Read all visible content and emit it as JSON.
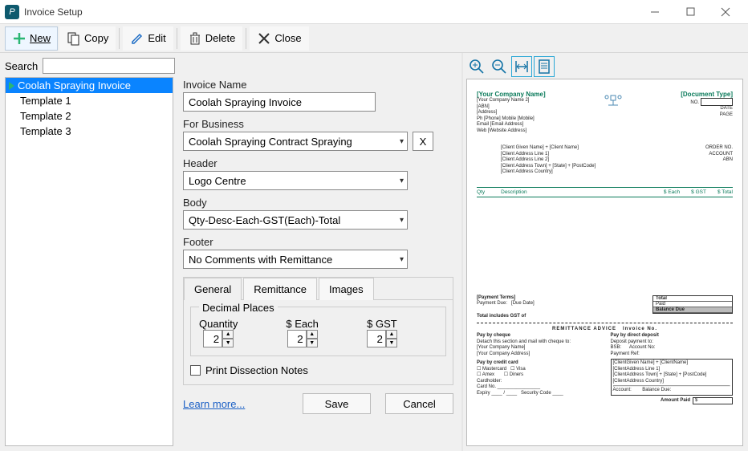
{
  "window": {
    "title": "Invoice Setup"
  },
  "toolbar": {
    "new_label": "New",
    "copy_label": "Copy",
    "edit_label": "Edit",
    "delete_label": "Delete",
    "close_label": "Close"
  },
  "search": {
    "label": "Search",
    "value": ""
  },
  "templates": {
    "items": [
      {
        "label": "Coolah Spraying Invoice",
        "selected": true,
        "has_marker": true
      },
      {
        "label": "Template 1",
        "selected": false,
        "has_marker": false
      },
      {
        "label": "Template 2",
        "selected": false,
        "has_marker": false
      },
      {
        "label": "Template 3",
        "selected": false,
        "has_marker": false
      }
    ]
  },
  "form": {
    "invoice_name_label": "Invoice Name",
    "invoice_name_value": "Coolah Spraying Invoice",
    "for_business_label": "For Business",
    "for_business_value": "Coolah Spraying Contract Spraying",
    "header_label": "Header",
    "header_value": "Logo Centre",
    "body_label": "Body",
    "body_value": "Qty-Desc-Each-GST(Each)-Total",
    "footer_label": "Footer",
    "footer_value": "No Comments with Remittance"
  },
  "tabs": {
    "general": "General",
    "remittance": "Remittance",
    "images": "Images"
  },
  "decimals": {
    "legend": "Decimal Places",
    "quantity_label": "Quantity",
    "quantity_value": "2",
    "each_label": "$ Each",
    "each_value": "2",
    "gst_label": "$ GST",
    "gst_value": "2"
  },
  "dissection": {
    "label": "Print Dissection Notes",
    "checked": false
  },
  "footer": {
    "learn_more": "Learn more...",
    "save": "Save",
    "cancel": "Cancel"
  },
  "preview": {
    "company_name": "[Your Company Name]",
    "company_name2": "[Your Company Name 2]",
    "abn": "[ABN]",
    "address": "[Address]",
    "phone": "Ph [Phone]   Mobile [Mobile]",
    "email": "Email [Email Address]",
    "web": "Web [Website Address]",
    "doc_type": "[Document Type]",
    "no_label": "NO.",
    "date_label": "DATE",
    "page_label": "PAGE",
    "client_name": "[Client  Given Name] + [Client Name]",
    "client_addr1": "[Client  Address Line 1]",
    "client_addr2": "[Client  Address Line 2]",
    "client_addr3": "[Client  Address Town] + [State] + [PostCode]",
    "client_addr4": "[Client  Address Country]",
    "order_no": "ORDER NO.",
    "account": "ACCOUNT",
    "abn2": "ABN",
    "col_qty": "Qty",
    "col_desc": "Description",
    "col_each": "$ Each",
    "col_gst": "$ GST",
    "col_total": "$ Total",
    "payment_terms": "[Payment Terms]",
    "payment_due": "Payment Due:",
    "due_date": "[Due Date]",
    "tot_total": "Total",
    "tot_paid": "Paid",
    "tot_balance": "Balance Due",
    "gst_line": "Total includes GST of",
    "remit_title": "REMITTANCE ADVICE",
    "remit_invno": "Invoice No.",
    "pay_cheque": "Pay by cheque",
    "cheque_line": "Detach this section and mail with cheque to:",
    "comp1": "[Your Company Name]",
    "comp2": "[Your Company Address]",
    "pay_deposit": "Pay by direct deposit",
    "dep_line": "Deposit payment to:",
    "bsb": "BSB:",
    "acctno": "Account No:",
    "payref": "Payment Ref:",
    "c_name": "[ClientGiven Name] + [ClientName]",
    "c_a1": "[ClientAddress Line 1]",
    "c_a2": "[ClientAddress Town] + [State] + [PostCode]",
    "c_a3": "[ClientAddress Country]",
    "acct2": "Account:",
    "bal2": "Balance Due:",
    "pay_card": "Pay by credit card",
    "mc": "Mastercard",
    "visa": "Visa",
    "amex": "Amex",
    "diners": "Diners",
    "cardholder": "Cardholder:",
    "cardno": "Card No.",
    "expiry": "Expiry",
    "seccode": "Security Code",
    "amt_paid": "Amount Paid",
    "dollar": "$"
  }
}
